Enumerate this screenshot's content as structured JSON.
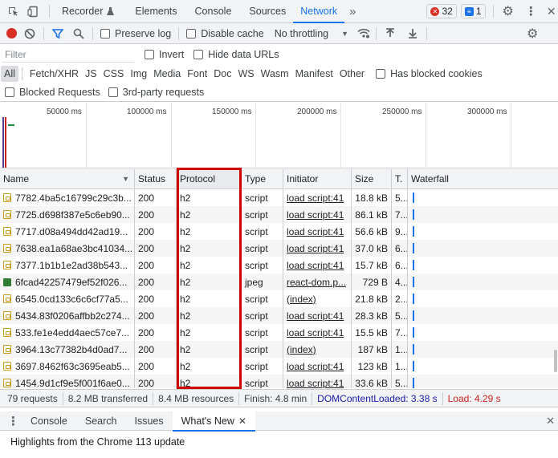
{
  "topbar": {
    "tabs": [
      "Recorder",
      "Elements",
      "Console",
      "Sources",
      "Network"
    ],
    "active_tab": "Network",
    "errors_count": "32",
    "messages_count": "1",
    "colors": {
      "accent": "#1a73e8",
      "error": "#d93025"
    }
  },
  "toolbar": {
    "preserve_log_label": "Preserve log",
    "disable_cache_label": "Disable cache",
    "throttling_value": "No throttling"
  },
  "filter": {
    "placeholder": "Filter",
    "invert_label": "Invert",
    "hide_data_urls_label": "Hide data URLs",
    "types": [
      "All",
      "Fetch/XHR",
      "JS",
      "CSS",
      "Img",
      "Media",
      "Font",
      "Doc",
      "WS",
      "Wasm",
      "Manifest",
      "Other"
    ],
    "active_type": "All",
    "has_blocked_cookies_label": "Has blocked cookies",
    "blocked_requests_label": "Blocked Requests",
    "third_party_label": "3rd-party requests"
  },
  "overview": {
    "ticks": [
      "50000 ms",
      "100000 ms",
      "150000 ms",
      "200000 ms",
      "250000 ms",
      "300000 ms"
    ]
  },
  "table": {
    "headers": {
      "name": "Name",
      "status": "Status",
      "protocol": "Protocol",
      "type": "Type",
      "initiator": "Initiator",
      "size": "Size",
      "time": "T.",
      "waterfall": "Waterfall"
    },
    "rows": [
      {
        "name": "7782.4ba5c16799c29c3b...",
        "status": "200",
        "protocol": "h2",
        "type": "script",
        "initiator": "load script:41",
        "size": "18.8 kB",
        "time": "5...",
        "icon": "script"
      },
      {
        "name": "7725.d698f387e5c6eb90...",
        "status": "200",
        "protocol": "h2",
        "type": "script",
        "initiator": "load script:41",
        "size": "86.1 kB",
        "time": "7...",
        "icon": "script"
      },
      {
        "name": "7717.d08a494dd42ad19...",
        "status": "200",
        "protocol": "h2",
        "type": "script",
        "initiator": "load script:41",
        "size": "56.6 kB",
        "time": "9...",
        "icon": "script"
      },
      {
        "name": "7638.ea1a68ae3bc41034...",
        "status": "200",
        "protocol": "h2",
        "type": "script",
        "initiator": "load script:41",
        "size": "37.0 kB",
        "time": "6...",
        "icon": "script"
      },
      {
        "name": "7377.1b1b1e2ad38b543...",
        "status": "200",
        "protocol": "h2",
        "type": "script",
        "initiator": "load script:41",
        "size": "15.7 kB",
        "time": "6...",
        "icon": "script"
      },
      {
        "name": "6fcad42257479ef52f026...",
        "status": "200",
        "protocol": "h2",
        "type": "jpeg",
        "initiator": "react-dom.p...",
        "size": "729 B",
        "time": "4...",
        "icon": "image"
      },
      {
        "name": "6545.0cd133c6c6cf77a5...",
        "status": "200",
        "protocol": "h2",
        "type": "script",
        "initiator": "(index)",
        "size": "21.8 kB",
        "time": "2...",
        "icon": "script"
      },
      {
        "name": "5434.83f0206affbb2c274...",
        "status": "200",
        "protocol": "h2",
        "type": "script",
        "initiator": "load script:41",
        "size": "28.3 kB",
        "time": "5...",
        "icon": "script"
      },
      {
        "name": "533.fe1e4edd4aec57ce7...",
        "status": "200",
        "protocol": "h2",
        "type": "script",
        "initiator": "load script:41",
        "size": "15.5 kB",
        "time": "7...",
        "icon": "script"
      },
      {
        "name": "3964.13c77382b4d0ad7...",
        "status": "200",
        "protocol": "h2",
        "type": "script",
        "initiator": "(index)",
        "size": "187 kB",
        "time": "1...",
        "icon": "script"
      },
      {
        "name": "3697.8462f63c3695eab5...",
        "status": "200",
        "protocol": "h2",
        "type": "script",
        "initiator": "load script:41",
        "size": "123 kB",
        "time": "1...",
        "icon": "script"
      },
      {
        "name": "1454.9d1cf9e5f001f6ae0...",
        "status": "200",
        "protocol": "h2",
        "type": "script",
        "initiator": "load script:41",
        "size": "33.6 kB",
        "time": "5...",
        "icon": "script"
      }
    ]
  },
  "statusbar": {
    "requests": "79 requests",
    "transferred": "8.2 MB transferred",
    "resources": "8.4 MB resources",
    "finish": "Finish: 4.8 min",
    "dom_content_loaded": "DOMContentLoaded: 3.38 s",
    "load": "Load: 4.29 s",
    "colors": {
      "dcl": "#1a1aa6",
      "load": "#c5221f"
    }
  },
  "drawer": {
    "tabs": [
      "Console",
      "Search",
      "Issues",
      "What's New"
    ],
    "active_tab": "What's New",
    "highlights_text": "Highlights from the Chrome 113 update"
  }
}
